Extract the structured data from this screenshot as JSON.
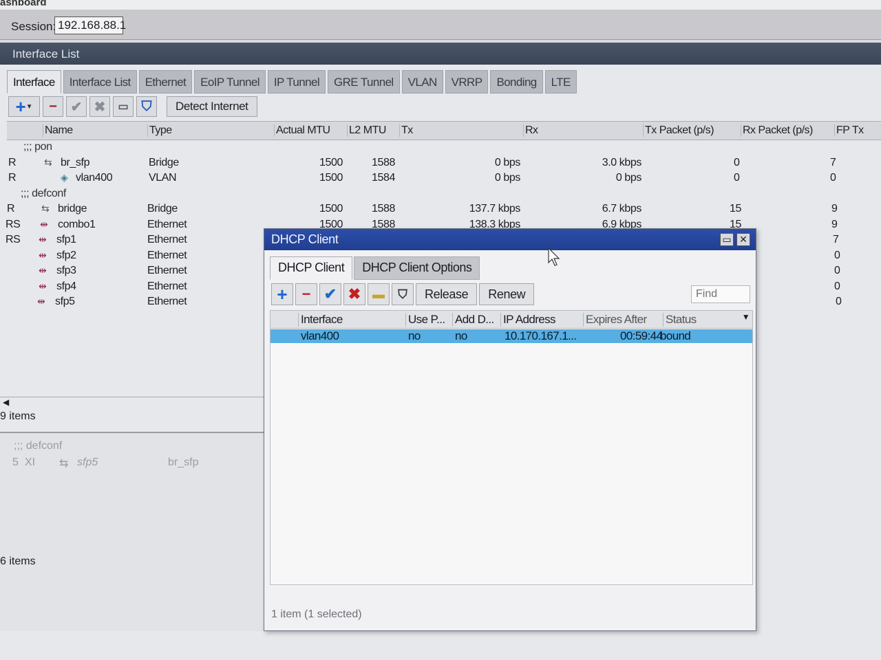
{
  "app": {
    "title": "ashboard"
  },
  "session": {
    "label": "Session:",
    "value": "192.168.88.1"
  },
  "interface_window": {
    "title": "Interface List",
    "tabs": [
      "Interface",
      "Interface List",
      "Ethernet",
      "EoIP Tunnel",
      "IP Tunnel",
      "GRE Tunnel",
      "VLAN",
      "VRRP",
      "Bonding",
      "LTE"
    ],
    "toolbar": {
      "detect_internet": "Detect Internet"
    },
    "columns": [
      "Name",
      "Type",
      "Actual MTU",
      "L2 MTU",
      "Tx",
      "Rx",
      "Tx Packet (p/s)",
      "Rx Packet (p/s)",
      "FP Tx"
    ],
    "groups": {
      "pon": ";;; pon",
      "defconf": ";;; defconf"
    },
    "rows": [
      {
        "flag": "R",
        "name": "br_sfp",
        "type": "Bridge",
        "mtu": "1500",
        "l2mtu": "1588",
        "tx": "0 bps",
        "rx": "3.0 kbps",
        "txp": "0",
        "rxp": "7"
      },
      {
        "flag": "R",
        "name": "vlan400",
        "type": "VLAN",
        "mtu": "1500",
        "l2mtu": "1584",
        "tx": "0 bps",
        "rx": "0 bps",
        "txp": "0",
        "rxp": "0"
      },
      {
        "flag": "R",
        "name": "bridge",
        "type": "Bridge",
        "mtu": "1500",
        "l2mtu": "1588",
        "tx": "137.7 kbps",
        "rx": "6.7 kbps",
        "txp": "15",
        "rxp": "9"
      },
      {
        "flag": "RS",
        "name": "combo1",
        "type": "Ethernet",
        "mtu": "1500",
        "l2mtu": "1588",
        "tx": "138.3 kbps",
        "rx": "6.9 kbps",
        "txp": "15",
        "rxp": "9"
      },
      {
        "flag": "RS",
        "name": "sfp1",
        "type": "Ethernet",
        "rxp": "7"
      },
      {
        "flag": "",
        "name": "sfp2",
        "type": "Ethernet",
        "rxp": "0"
      },
      {
        "flag": "",
        "name": "sfp3",
        "type": "Ethernet",
        "rxp": "0"
      },
      {
        "flag": "",
        "name": "sfp4",
        "type": "Ethernet",
        "rxp": "0"
      },
      {
        "flag": "",
        "name": "sfp5",
        "type": "Ethernet",
        "rxp": "0"
      }
    ],
    "items_count": "9 items",
    "lower": {
      "group": ";;; defconf",
      "num": "5",
      "flags": "XI",
      "iface": "sfp5",
      "bridge": "br_sfp",
      "items_count": "6 items"
    }
  },
  "dhcp_dialog": {
    "title": "DHCP Client",
    "tabs": [
      "DHCP Client",
      "DHCP Client Options"
    ],
    "buttons": {
      "release": "Release",
      "renew": "Renew"
    },
    "find_placeholder": "Find",
    "columns": [
      "Interface",
      "Use P...",
      "Add D...",
      "IP Address",
      "Expires After",
      "Status"
    ],
    "row": {
      "interface": "vlan400",
      "use_peer": "no",
      "add_default": "no",
      "ip": "10.170.167.1...",
      "expires": "00:59:44",
      "status": "bound"
    },
    "status_text": "1 item (1 selected)"
  }
}
